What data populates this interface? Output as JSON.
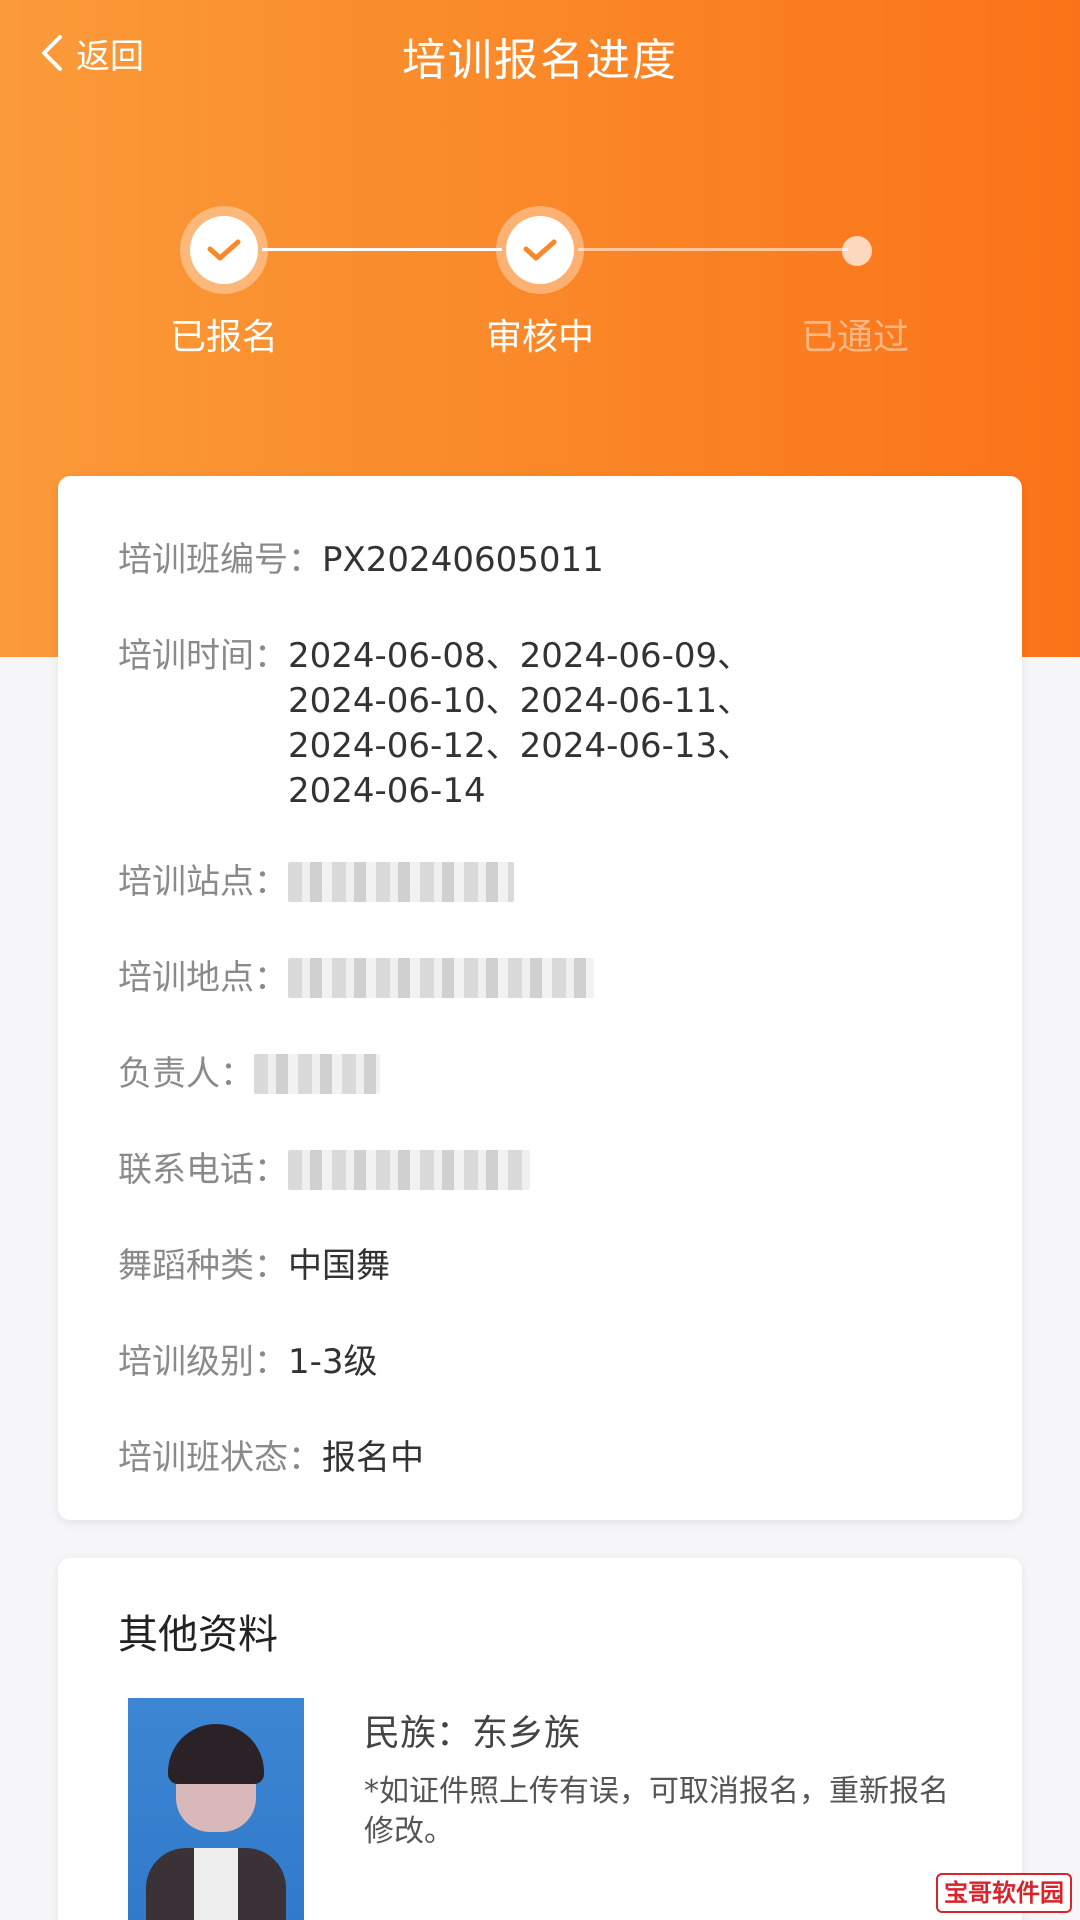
{
  "header": {
    "back_label": "返回",
    "title": "培训报名进度"
  },
  "steps": [
    {
      "label": "已报名",
      "state": "done"
    },
    {
      "label": "审核中",
      "state": "done"
    },
    {
      "label": "已通过",
      "state": "pending"
    }
  ],
  "info": {
    "class_no": {
      "label": "培训班编号：",
      "value": "PX20240605011"
    },
    "time": {
      "label": "培训时间：",
      "lines": [
        "2024-06-08、2024-06-09、",
        "2024-06-10、2024-06-11、",
        "2024-06-12、2024-06-13、",
        "2024-06-14"
      ]
    },
    "site": {
      "label": "培训站点："
    },
    "place": {
      "label": "培训地点："
    },
    "person": {
      "label": "负责人："
    },
    "phone": {
      "label": "联系电话："
    },
    "dance_type": {
      "label": "舞蹈种类：",
      "value": "中国舞"
    },
    "level": {
      "label": "培训级别：",
      "value": "1-3级"
    },
    "status": {
      "label": "培训班状态：",
      "value": "报名中"
    }
  },
  "other": {
    "title": "其他资料",
    "ethnic": "民族：东乡族",
    "note": "*如证件照上传有误，可取消报名，重新报名修改。"
  },
  "watermark": "宝哥软件园",
  "colors": {
    "header_start": "#fb9a39",
    "header_end": "#fb7318",
    "check": "#f7892a"
  }
}
